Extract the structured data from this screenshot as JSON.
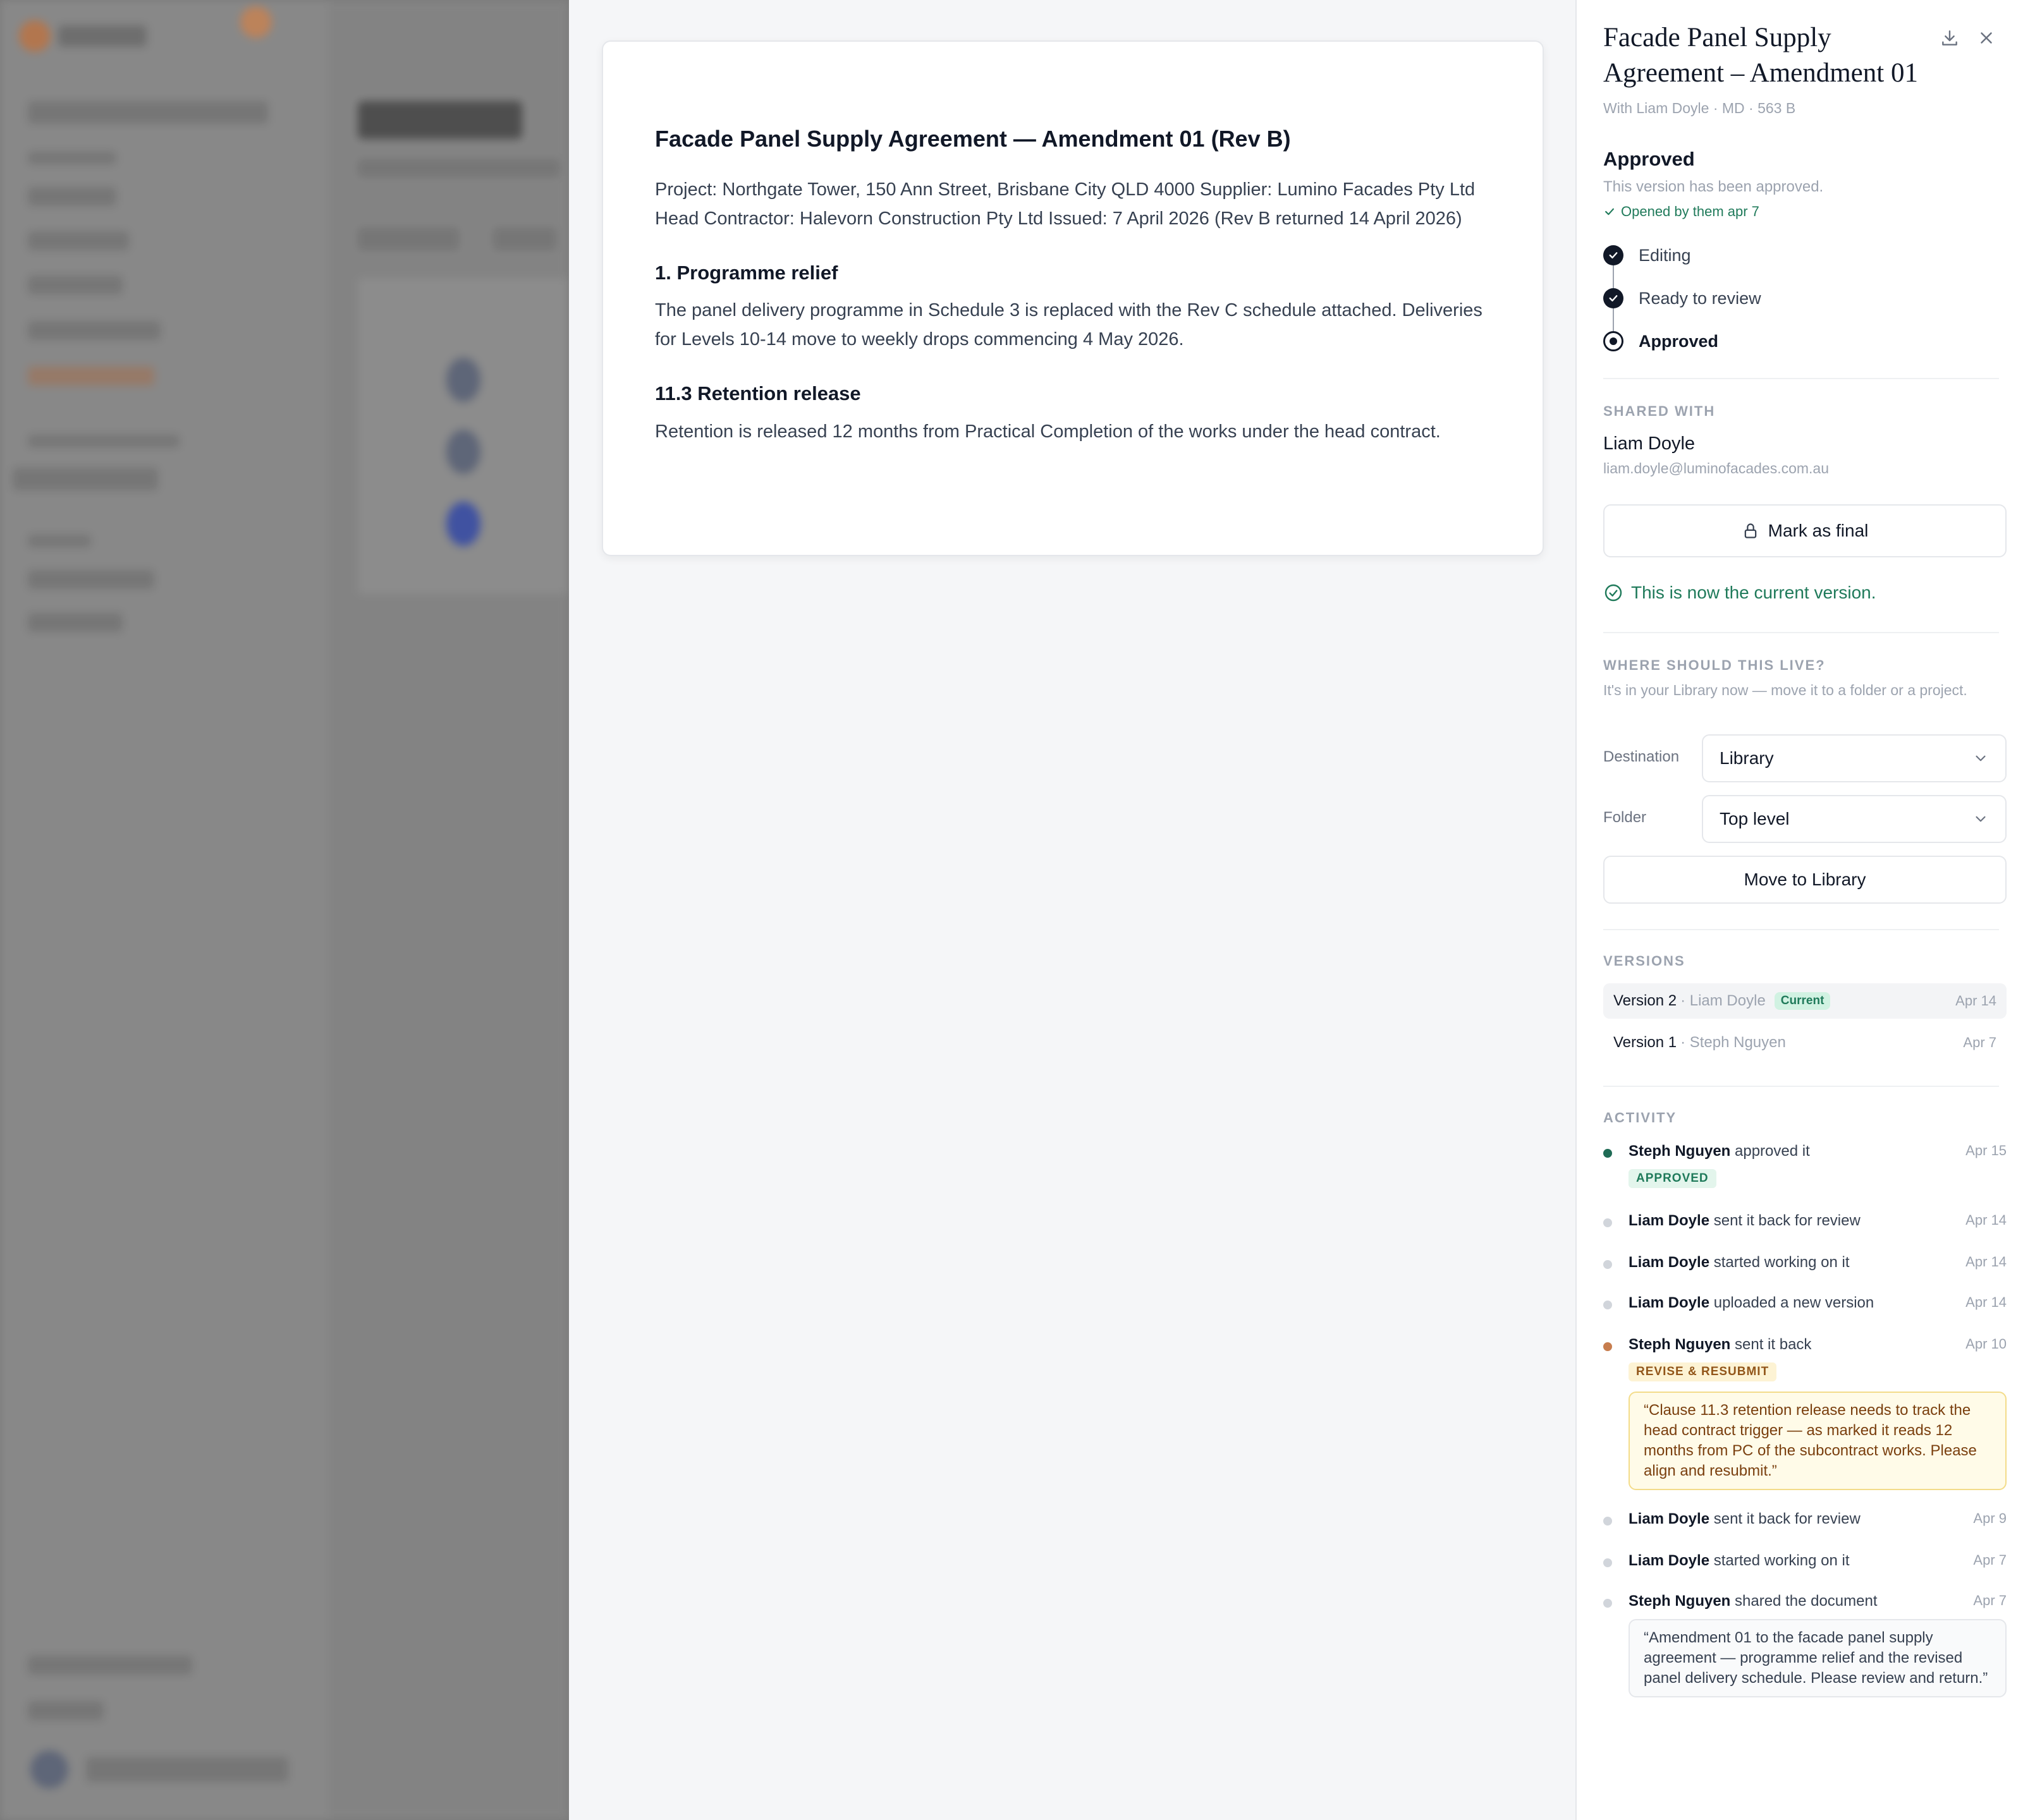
{
  "document": {
    "title": "Facade Panel Supply Agreement — Amendment 01 (Rev B)",
    "intro": "Project: Northgate Tower, 150 Ann Street, Brisbane City QLD 4000 Supplier: Lumino Facades Pty Ltd Head Contractor: Halevorn Construction Pty Ltd Issued: 7 April 2026 (Rev B returned 14 April 2026)",
    "sections": [
      {
        "heading": "1. Programme relief",
        "body": "The panel delivery programme in Schedule 3 is replaced with the Rev C schedule attached. Deliveries for Levels 10-14 move to weekly drops commencing 4 May 2026."
      },
      {
        "heading": "11.3 Retention release",
        "body": "Retention is released 12 months from Practical Completion of the works under the head contract."
      }
    ]
  },
  "panel": {
    "title": "Facade Panel Supply Agreement – Amendment 01",
    "meta": "With Liam Doyle · MD · 563 B",
    "status": {
      "label": "Approved",
      "description": "This version has been approved.",
      "opened": "Opened by them apr 7",
      "steps": [
        "Editing",
        "Ready to review",
        "Approved"
      ]
    },
    "shared": {
      "label": "SHARED WITH",
      "name": "Liam Doyle",
      "email": "liam.doyle@luminofacades.com.au",
      "mark_final": "Mark as final",
      "current_msg": "This is now the current version."
    },
    "location": {
      "label": "WHERE SHOULD THIS LIVE?",
      "help": "It's in your Library now — move it to a folder or a project.",
      "destination_label": "Destination",
      "destination_value": "Library",
      "folder_label": "Folder",
      "folder_value": "Top level",
      "move_button": "Move to Library"
    },
    "versions": {
      "label": "VERSIONS",
      "items": [
        {
          "name": "Version 2",
          "by": "· Liam Doyle",
          "badge": "Current",
          "date": "Apr 14"
        },
        {
          "name": "Version 1",
          "by": "· Steph Nguyen",
          "date": "Apr 7"
        }
      ]
    },
    "activity": {
      "label": "ACTIVITY",
      "items": [
        {
          "who": "Steph Nguyen",
          "what": "approved it",
          "date": "Apr 15",
          "tag": "APPROVED"
        },
        {
          "who": "Liam Doyle",
          "what": "sent it back for review",
          "date": "Apr 14"
        },
        {
          "who": "Liam Doyle",
          "what": "started working on it",
          "date": "Apr 14"
        },
        {
          "who": "Liam Doyle",
          "what": "uploaded a new version",
          "date": "Apr 14"
        },
        {
          "who": "Steph Nguyen",
          "what": "sent it back",
          "date": "Apr 10",
          "tag": "REVISE & RESUBMIT",
          "quote": "“Clause 11.3 retention release needs to track the head contract trigger — as marked it reads 12 months from PC of the subcontract works. Please align and resubmit.”"
        },
        {
          "who": "Liam Doyle",
          "what": "sent it back for review",
          "date": "Apr 9"
        },
        {
          "who": "Liam Doyle",
          "what": "started working on it",
          "date": "Apr 7"
        },
        {
          "who": "Steph Nguyen",
          "what": "shared the document",
          "date": "Apr 7",
          "quote": "“Amendment 01 to the facade panel supply agreement — programme relief and the revised panel delivery schedule. Please review and return.”"
        }
      ]
    }
  },
  "colors": {
    "accent_green": "#1f7a5a",
    "warning_orange": "#c77d4e",
    "overlay": "#7a7a7a"
  }
}
